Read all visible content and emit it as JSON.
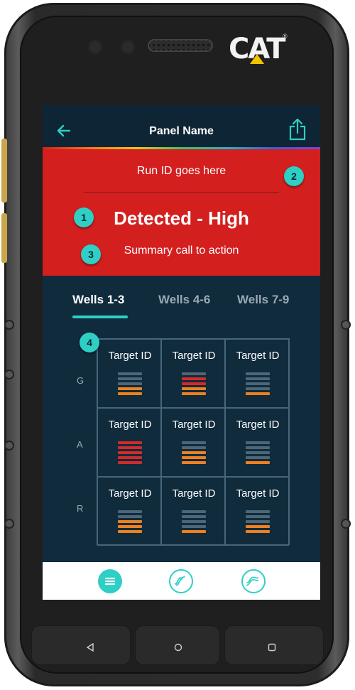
{
  "device": {
    "brand_logo": "CAT",
    "registered_mark": "®"
  },
  "appbar": {
    "title": "Panel Name",
    "back_icon": "arrow-left-icon",
    "share_icon": "share-icon"
  },
  "hero": {
    "run_id": "Run ID goes here",
    "headline": "Detected - High",
    "summary": "Summary call to action",
    "background_color": "#d41f1f"
  },
  "annotations": {
    "one": "1",
    "two": "2",
    "three": "3",
    "four": "4"
  },
  "tabs": [
    {
      "label": "Wells 1-3",
      "active": true
    },
    {
      "label": "Wells 4-6",
      "active": false
    },
    {
      "label": "Wells 7-9",
      "active": false
    }
  ],
  "rows": [
    "G",
    "A",
    "R"
  ],
  "grid": [
    [
      {
        "label": "Target ID",
        "level": 2,
        "color": "orange"
      },
      {
        "label": "Target ID",
        "level": 4,
        "color": "red-orange"
      },
      {
        "label": "Target ID",
        "level": 1,
        "color": "orange"
      }
    ],
    [
      {
        "label": "Target ID",
        "level": 5,
        "color": "red"
      },
      {
        "label": "Target ID",
        "level": 3,
        "color": "orange"
      },
      {
        "label": "Target ID",
        "level": 1,
        "color": "orange"
      }
    ],
    [
      {
        "label": "Target ID",
        "level": 3,
        "color": "orange"
      },
      {
        "label": "Target ID",
        "level": 1,
        "color": "orange"
      },
      {
        "label": "Target ID",
        "level": 2,
        "color": "orange"
      }
    ]
  ],
  "bottom_nav": [
    {
      "icon": "list-icon",
      "filled": true
    },
    {
      "icon": "s-curve-icon",
      "filled": false
    },
    {
      "icon": "double-curve-icon",
      "filled": false
    }
  ],
  "system_nav": [
    {
      "icon": "back-triangle-icon"
    },
    {
      "icon": "home-circle-icon"
    },
    {
      "icon": "recents-square-icon"
    }
  ],
  "colors": {
    "accent": "#2ecfc5",
    "screen_bg": "#0f2b3c",
    "bar_grey": "#4d6678",
    "bar_orange": "#f0801e",
    "bar_red": "#d42a2a"
  }
}
